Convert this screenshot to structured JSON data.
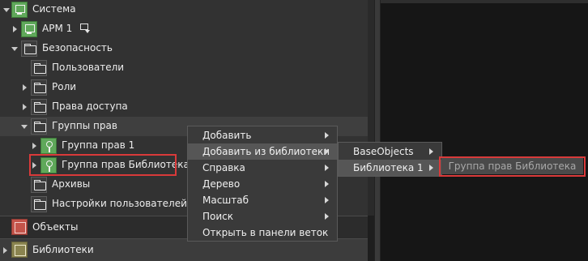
{
  "tree": {
    "nodes": [
      {
        "label": "Система",
        "icon": "system-icon"
      },
      {
        "label": "АРМ 1",
        "icon": "workstation-icon"
      },
      {
        "label": "Безопасность",
        "icon": "folder-icon"
      },
      {
        "label": "Пользователи",
        "icon": "folder-icon"
      },
      {
        "label": "Роли",
        "icon": "folder-icon"
      },
      {
        "label": "Права доступа",
        "icon": "folder-icon"
      },
      {
        "label": "Группы прав",
        "icon": "folder-icon"
      },
      {
        "label": "Группа прав 1",
        "icon": "key-icon"
      },
      {
        "label": "Группа прав Библиотека",
        "icon": "key-icon"
      },
      {
        "label": "Архивы",
        "icon": "folder-icon"
      },
      {
        "label": "Настройки пользователей",
        "icon": "folder-icon"
      }
    ]
  },
  "bottom": {
    "objects_label": "Объекты",
    "libraries_label": "Библиотеки"
  },
  "context_menu": {
    "items": [
      {
        "label": "Добавить",
        "has_submenu": true
      },
      {
        "label": "Добавить из библиотеки",
        "has_submenu": true
      },
      {
        "label": "Справка",
        "has_submenu": true
      },
      {
        "label": "Дерево",
        "has_submenu": true
      },
      {
        "label": "Масштаб",
        "has_submenu": true
      },
      {
        "label": "Поиск",
        "has_submenu": true
      },
      {
        "label": "Открыть в панели веток",
        "has_submenu": false
      }
    ]
  },
  "submenu": {
    "items": [
      {
        "label": "BaseObjects",
        "has_submenu": true
      },
      {
        "label": "Библиотека 1",
        "has_submenu": true
      }
    ]
  },
  "submenu2": {
    "item_label": "Группа прав Библиотека"
  },
  "colors": {
    "highlight_border": "#d93a3a",
    "tree_bg": "#323232",
    "menu_bg": "#3a3a3a"
  }
}
